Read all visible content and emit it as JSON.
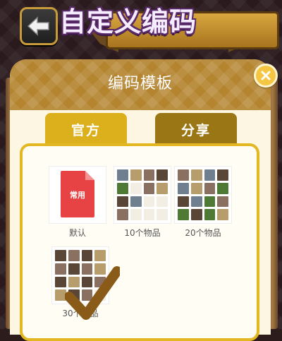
{
  "header": {
    "title": "自定义编码"
  },
  "dialog": {
    "title": "编码模板",
    "tabs": [
      {
        "label": "官方",
        "active": true
      },
      {
        "label": "分享",
        "active": false
      }
    ]
  },
  "templates": [
    {
      "label": "默认",
      "icon_text": "常用",
      "selected": false
    },
    {
      "label": "10个物品",
      "selected": false
    },
    {
      "label": "20个物品",
      "selected": false
    },
    {
      "label": "30个物品",
      "selected": true
    }
  ],
  "colors": {
    "header": "#b4842f",
    "tab_active": "#dcb01c",
    "tab_inactive": "#9a7714",
    "panel_border": "#e2b722",
    "doc_red": "#e74345",
    "check": "#8a5a18"
  },
  "icons": {
    "back": "back-arrow-icon",
    "close": "close-icon",
    "document": "document-icon",
    "check": "checkmark-icon"
  }
}
